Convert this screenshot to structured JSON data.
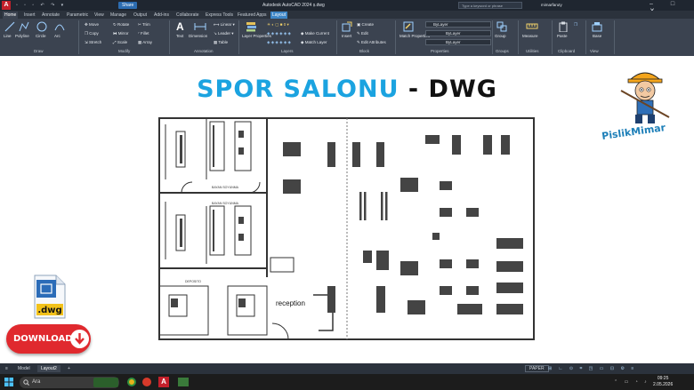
{
  "titlebar": {
    "app_logo": "A",
    "qat": "▫ ▫ ▫ ↶ ↷ ▾",
    "share_label": "Share",
    "window_title": "Autodesk AutoCAD 2024   ṣ.dwg",
    "search_placeholder": "Type a keyword or phrase",
    "user_name": "mimarfaruty",
    "window_controls": "–  □  ✕"
  },
  "ribbon_tabs": [
    "Home",
    "Insert",
    "Annotate",
    "Parametric",
    "View",
    "Manage",
    "Output",
    "Add-ins",
    "Collaborate",
    "Express Tools",
    "Featured Apps",
    "Layout"
  ],
  "ribbon": {
    "draw": {
      "line": "Line",
      "polyline": "Polyline",
      "circle": "Circle",
      "arc": "Arc"
    },
    "modify": {
      "move": "Move",
      "rotate": "Rotate",
      "trim": "Trim",
      "copy": "Copy",
      "mirror": "Mirror",
      "fillet": "Fillet",
      "stretch": "Stretch",
      "scale": "Scale",
      "array": "Array"
    },
    "annotation": {
      "text": "Text",
      "dimension": "Dimension",
      "linear": "Linear",
      "leader": "Leader",
      "table": "Table"
    },
    "layers": {
      "layer_properties": "Layer Properties",
      "make_current": "Make Current",
      "match_layer": "Match Layer"
    },
    "block": {
      "insert": "Insert",
      "create": "Create",
      "edit": "Edit",
      "edit_attributes": "Edit Attributes"
    },
    "properties": {
      "match_properties": "Match Properties",
      "bylayer_1": "ByLayer",
      "bylayer_2": "ByLayer",
      "bylayer_3": "ByLayer"
    },
    "groups": {
      "group": "Group"
    },
    "utilities": {
      "measure": "Measure"
    },
    "clipboard": {
      "paste": "Paste"
    },
    "view": {
      "base": "Base"
    },
    "panel_labels": [
      "Draw",
      "Modify",
      "Annotation",
      "Layers",
      "Block",
      "Properties",
      "Groups",
      "Utilities",
      "Clipboard",
      "View"
    ]
  },
  "headline": {
    "part1": "SPOR SALONU",
    "dash": " - ",
    "part2": "DWG"
  },
  "brand": {
    "name": "PislikMimar"
  },
  "file_badge": {
    "ext": ".dwg"
  },
  "download_button": {
    "label": "DOWNLOAD"
  },
  "plan": {
    "reception_label": "reception",
    "room_label_1": "BAYAN SOYUNMA",
    "room_label_2": "BAYAN SOYUNMA",
    "depot_label": "DEPOSITO"
  },
  "statusbar": {
    "model_tab": "Model",
    "layout_tab": "Layout2",
    "add_tab": "+",
    "paper": "PAPER"
  },
  "taskbar": {
    "search_placeholder": "Ara",
    "time": "09:25",
    "date": "2.05.2026"
  },
  "colors": {
    "accent_blue": "#1ba3e0",
    "download_red": "#e0292e",
    "ribbon_bg": "#3b4350",
    "title_bg": "#1f2630"
  }
}
